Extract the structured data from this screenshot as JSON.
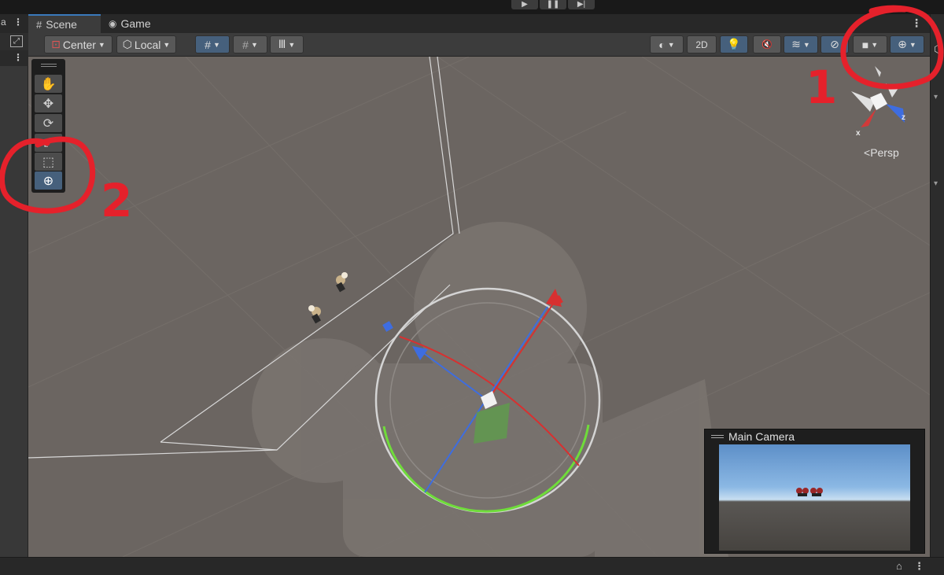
{
  "playbar": {
    "play_icon": "play-icon",
    "pause_icon": "pause-icon",
    "step_icon": "step-icon",
    "glyphs": {
      "play": "▶",
      "pause": "❚❚",
      "step": "▶|"
    }
  },
  "tabs": [
    {
      "label": "Scene",
      "icon": "#"
    },
    {
      "label": "Game",
      "icon": "🎮"
    }
  ],
  "toolbar": {
    "pivot_label": "Center",
    "space_label": "Local",
    "mode_2d_label": "2D"
  },
  "tools": [
    "hand-icon",
    "move-icon",
    "rotate-icon",
    "scale-icon",
    "rect-icon",
    "transform-icon"
  ],
  "tool_glyphs": [
    "✋",
    "✥",
    "⟳",
    "⤢",
    "⬚",
    "⊕"
  ],
  "active_tool_index": 5,
  "gizmo": {
    "projection_label": "Persp",
    "axis_x": "x",
    "axis_z": "z",
    "colors": {
      "x": "#d23a3a",
      "y": "#7ec84a",
      "z": "#3e6de0"
    }
  },
  "camera_preview": {
    "title": "Main Camera"
  },
  "annotations": {
    "label_1": "1",
    "label_2": "2",
    "color": "#e5212b"
  },
  "left_strip": {
    "glyph_a": "a",
    "glyph_b": "⋮"
  },
  "right_strip": {
    "glyph": "▾"
  }
}
